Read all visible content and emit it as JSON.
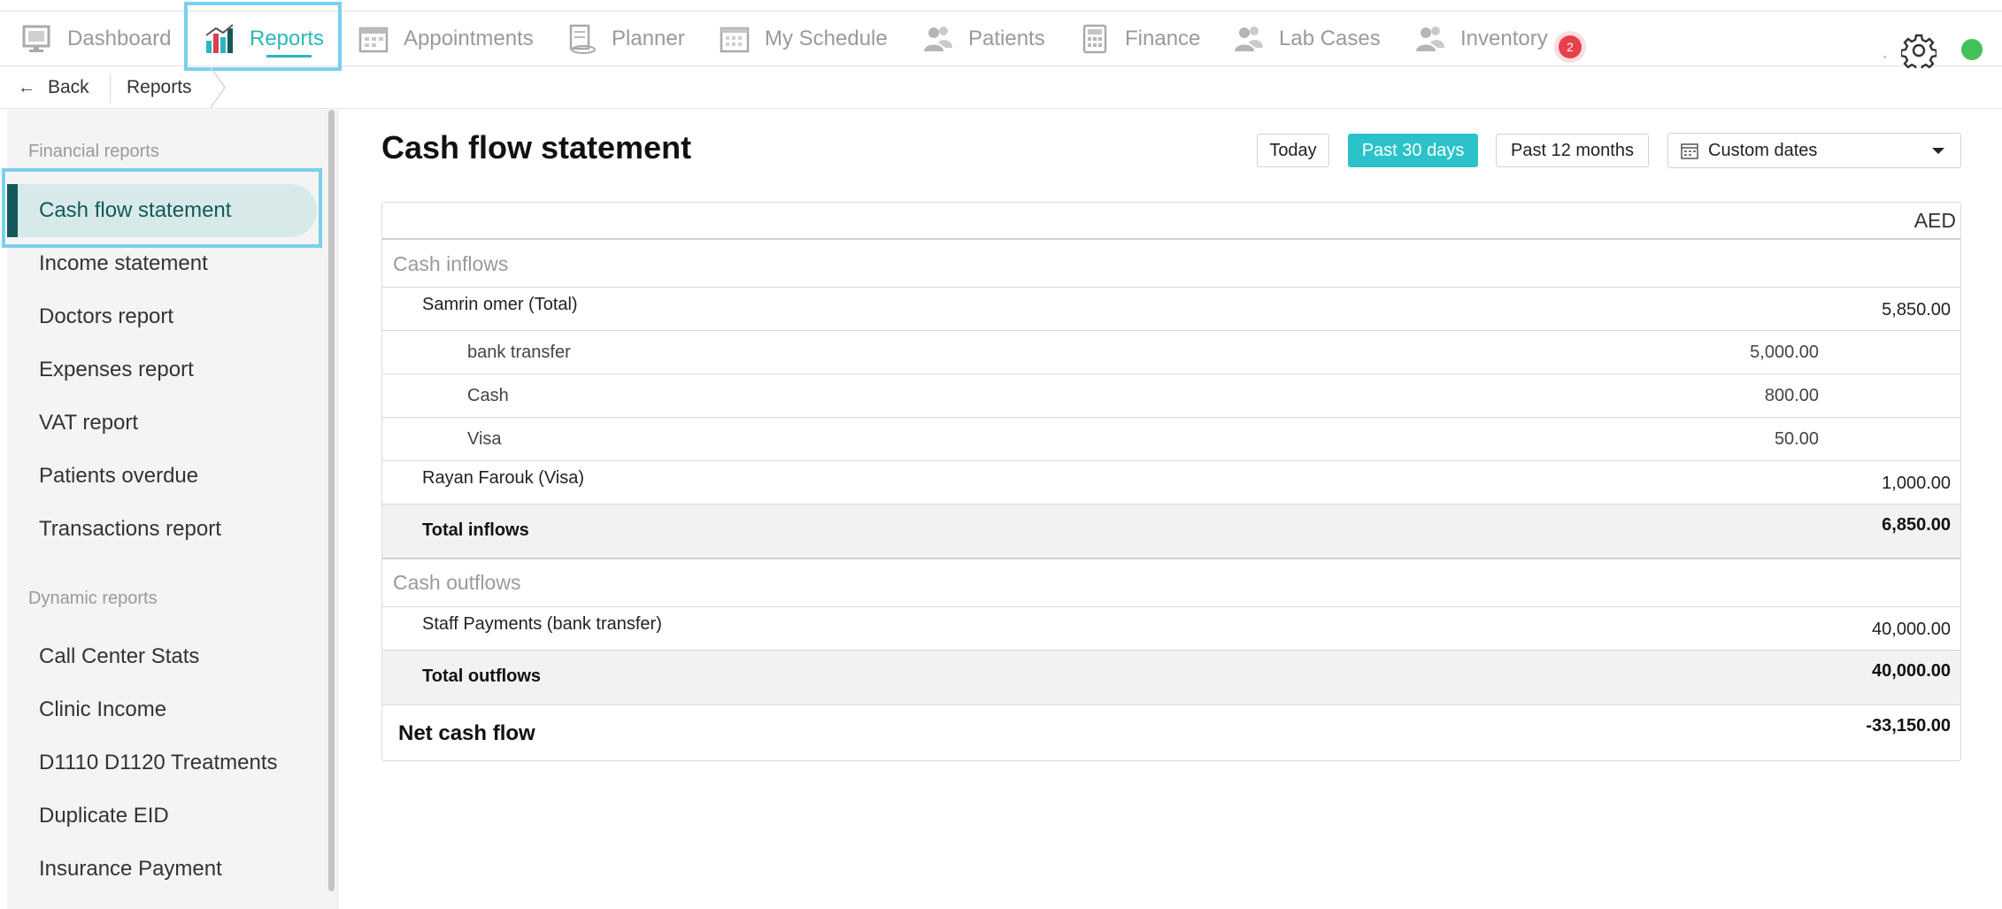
{
  "nav": {
    "items": [
      {
        "label": "Dashboard",
        "icon": "dashboard-icon"
      },
      {
        "label": "Reports",
        "icon": "bar-chart-icon"
      },
      {
        "label": "Appointments",
        "icon": "calendar-icon"
      },
      {
        "label": "Planner",
        "icon": "planner-icon"
      },
      {
        "label": "My Schedule",
        "icon": "schedule-icon"
      },
      {
        "label": "Patients",
        "icon": "patients-icon"
      },
      {
        "label": "Finance",
        "icon": "calculator-icon"
      },
      {
        "label": "Lab Cases",
        "icon": "lab-cases-icon"
      },
      {
        "label": "Inventory",
        "icon": "inventory-icon"
      }
    ],
    "active": "Reports",
    "inventory_badge": "2",
    "accent": "#2bb7bd",
    "status_color": "#44c058"
  },
  "breadcrumb": {
    "back_label": "Back",
    "current": "Reports"
  },
  "sidebar": {
    "financial_heading": "Financial reports",
    "financial_items": [
      "Cash flow statement",
      "Income statement",
      "Doctors report",
      "Expenses report",
      "VAT report",
      "Patients overdue",
      "Transactions report"
    ],
    "dynamic_heading": "Dynamic reports",
    "dynamic_items": [
      "Call Center Stats",
      "Clinic Income",
      "D1110 D1120 Treatments",
      "Duplicate EID",
      "Insurance Payment"
    ],
    "selected": "Cash flow statement"
  },
  "main": {
    "title": "Cash flow statement",
    "filters": {
      "today": "Today",
      "past_30": "Past 30 days",
      "past_12": "Past 12 months",
      "custom": "Custom dates",
      "selected": "Past 30 days"
    },
    "currency": "AED",
    "inflows_heading": "Cash inflows",
    "inflows": {
      "samrin_label": "Samrin omer (Total)",
      "samrin_amount": "5,850.00",
      "bank_label": "bank transfer",
      "bank_amount": "5,000.00",
      "cash_label": "Cash",
      "cash_amount": "800.00",
      "visa_label": "Visa",
      "visa_amount": "50.00",
      "rayan_label": "Rayan Farouk (Visa)",
      "rayan_amount": "1,000.00",
      "total_label": "Total inflows",
      "total_amount": "6,850.00"
    },
    "outflows_heading": "Cash outflows",
    "outflows": {
      "staff_label": "Staff Payments (bank transfer)",
      "staff_amount": "40,000.00",
      "total_label": "Total outflows",
      "total_amount": "40,000.00"
    },
    "net_label": "Net cash flow",
    "net_amount": "-33,150.00"
  }
}
